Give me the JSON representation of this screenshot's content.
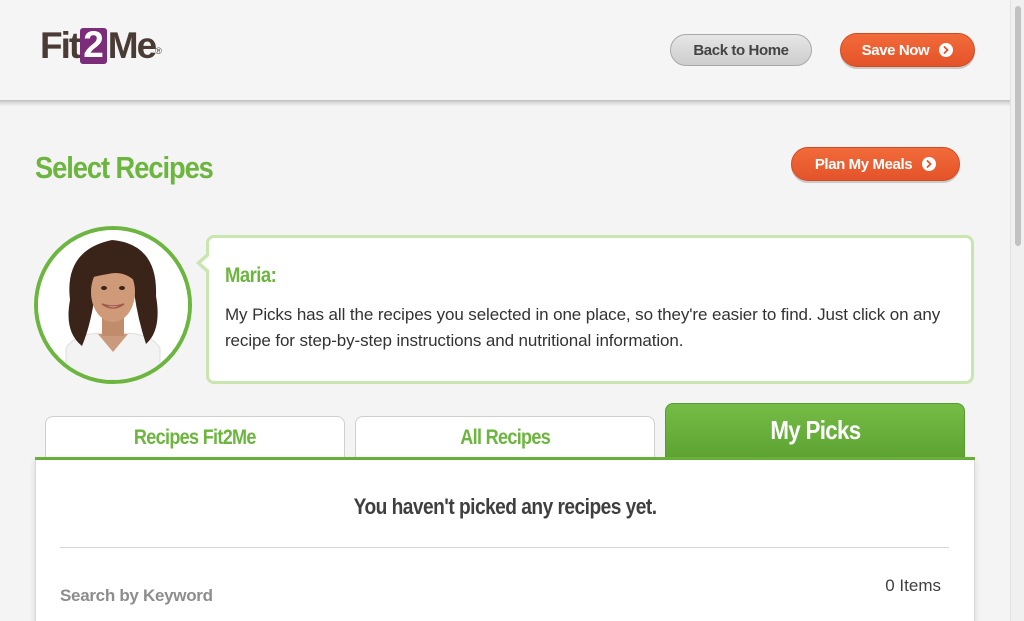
{
  "header": {
    "logo": {
      "pre": "Fit",
      "mid": "2",
      "post": "Me",
      "tm": "®"
    },
    "back_home_label": "Back to Home",
    "save_now_label": "Save Now"
  },
  "page": {
    "title": "Select Recipes",
    "plan_meals_label": "Plan My Meals"
  },
  "coach": {
    "name": "Maria:",
    "message": "My Picks has all the recipes you selected in one place, so they're easier to find. Just click on any recipe for step-by-step instructions and nutritional information."
  },
  "tabs": [
    {
      "label": "Recipes Fit2Me",
      "active": false
    },
    {
      "label": "All Recipes",
      "active": false
    },
    {
      "label": "My Picks",
      "active": true
    }
  ],
  "picks": {
    "empty_message": "You haven't picked any recipes yet.",
    "search_label": "Search by Keyword",
    "items_count": "0 Items"
  },
  "colors": {
    "brand_green": "#6cb53e",
    "accent_orange": "#ec5f31",
    "logo_purple": "#7b2d7a",
    "logo_brown": "#4a3b34"
  },
  "icons": {
    "button_arrow": "chevron-right-circle-icon"
  }
}
